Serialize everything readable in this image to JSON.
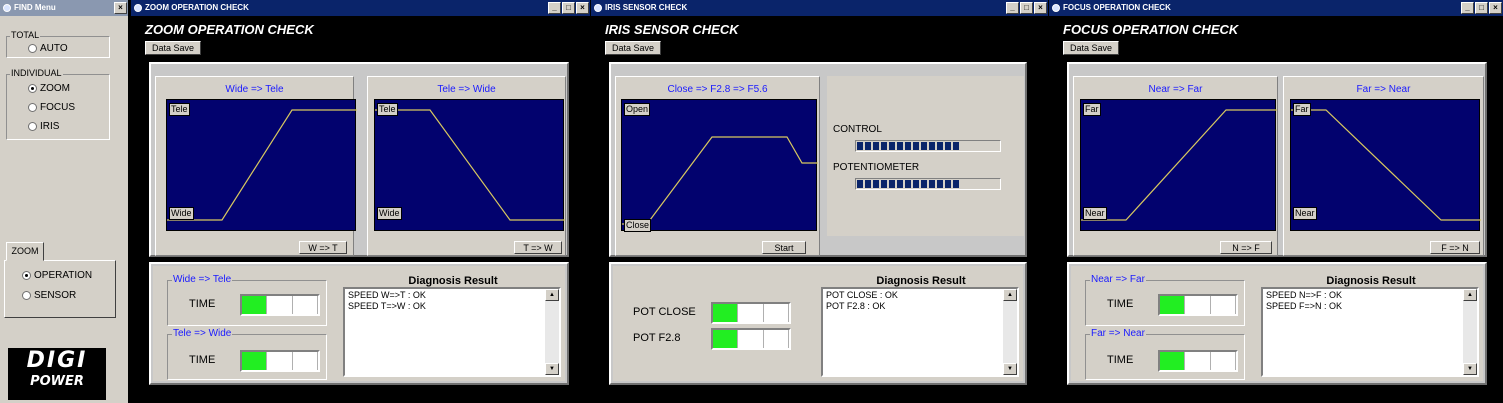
{
  "menu": {
    "title": "FIND Menu",
    "total_legend": "TOTAL",
    "total_options": [
      "AUTO"
    ],
    "individual_legend": "INDIVIDUAL",
    "individual_options": [
      "ZOOM",
      "FOCUS",
      "IRIS"
    ],
    "individual_selected": "ZOOM",
    "zoom_tab": "ZOOM",
    "zoom_options": [
      "OPERATION",
      "SENSOR"
    ],
    "zoom_selected": "OPERATION",
    "logo_line1": "DIGI",
    "logo_line2": "POWER"
  },
  "zoom": {
    "window_title": "ZOOM OPERATION CHECK",
    "heading": "ZOOM OPERATION CHECK",
    "data_save": "Data Save",
    "graph1": {
      "title": "Wide =>  Tele",
      "top_label": "Tele",
      "bottom_label": "Wide",
      "button": "W => T"
    },
    "graph2": {
      "title": "Tele => Wide",
      "top_label": "Tele",
      "bottom_label": "Wide",
      "button": "T => W"
    },
    "group1": {
      "legend": "Wide => Tele",
      "label": "TIME",
      "level": 1
    },
    "group2": {
      "legend": "Tele => Wide",
      "label": "TIME",
      "level": 1
    },
    "diag_title": "Diagnosis Result",
    "results": [
      "SPEED W=>T : OK",
      "SPEED T=>W : OK"
    ]
  },
  "iris": {
    "window_title": "IRIS SENSOR CHECK",
    "heading": "IRIS SENSOR CHECK",
    "data_save": "Data Save",
    "graph": {
      "title": "Close => F2.8 => F5.6",
      "top_label": "Open",
      "bottom_label": "Close",
      "button": "Start"
    },
    "control_label": "CONTROL",
    "control_level": 0.72,
    "pot_label": "POTENTIOMETER",
    "pot_level": 0.72,
    "rows": [
      {
        "label": "POT CLOSE",
        "level": 1
      },
      {
        "label": "POT F2.8",
        "level": 1
      }
    ],
    "diag_title": "Diagnosis Result",
    "results": [
      "POT CLOSE : OK",
      "POT F2.8 : OK"
    ]
  },
  "focus": {
    "window_title": "FOCUS OPERATION CHECK",
    "heading": "FOCUS OPERATION CHECK",
    "data_save": "Data Save",
    "graph1": {
      "title": "Near => Far",
      "top_label": "Far",
      "bottom_label": "Near",
      "button": "N => F"
    },
    "graph2": {
      "title": "Far => Near",
      "top_label": "Far",
      "bottom_label": "Near",
      "button": "F => N"
    },
    "group1": {
      "legend": "Near => Far",
      "label": "TIME",
      "level": 1
    },
    "group2": {
      "legend": "Far => Near",
      "label": "TIME",
      "level": 1
    },
    "diag_title": "Diagnosis Result",
    "results": [
      "SPEED N=>F : OK",
      "SPEED F=>N : OK"
    ]
  },
  "colors": {
    "trace": "#d8c860",
    "plot_bg": "#02026e",
    "title_bar": "#0a246a",
    "meter_on": "#22ee22",
    "graph_title": "#1a1aff"
  },
  "icons": [
    "app-icon",
    "minimize-icon",
    "maximize-icon",
    "close-icon",
    "scroll-up-icon",
    "scroll-down-icon"
  ]
}
